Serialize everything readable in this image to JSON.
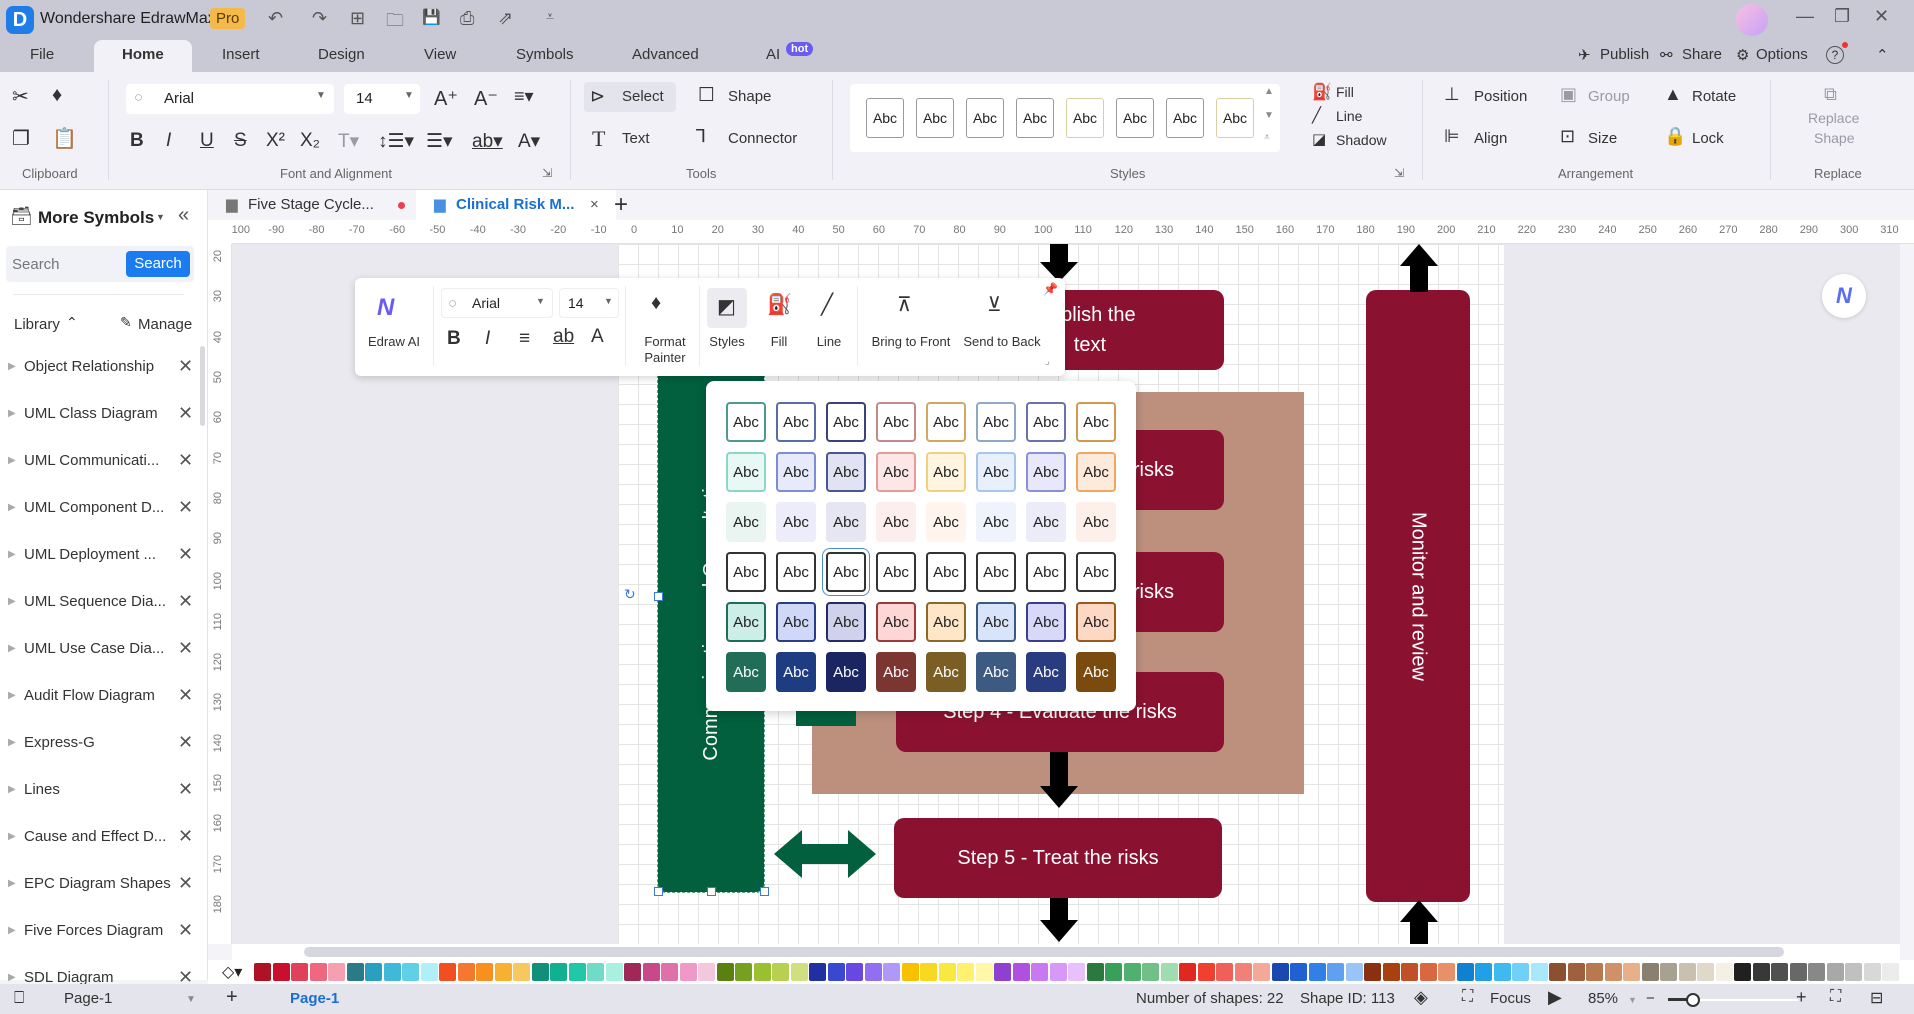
{
  "app": {
    "title": "Wondershare EdrawMax",
    "badge": "Pro",
    "logo_letter": "D"
  },
  "quick_access": [
    {
      "name": "undo-icon",
      "glyph": "↶"
    },
    {
      "name": "redo-icon",
      "glyph": "↷"
    },
    {
      "name": "new-icon",
      "glyph": "⊞"
    },
    {
      "name": "open-folder-icon",
      "glyph": "🗀"
    },
    {
      "name": "save-icon",
      "glyph": "💾"
    },
    {
      "name": "print-icon",
      "glyph": "⎙"
    },
    {
      "name": "export-icon",
      "glyph": "⇗"
    },
    {
      "name": "customize-icon",
      "glyph": "⩡"
    }
  ],
  "window_controls": {
    "minimize": "—",
    "restore": "❐",
    "close": "✕"
  },
  "menu": {
    "tabs": [
      "File",
      "Home",
      "Insert",
      "Design",
      "View",
      "Symbols",
      "Advanced",
      "AI"
    ],
    "active": "Home",
    "ai_badge": "hot",
    "right": {
      "publish": "Publish",
      "share": "Share",
      "options": "Options",
      "help": "?"
    }
  },
  "ribbon": {
    "clipboard": {
      "label": "Clipboard"
    },
    "font": {
      "label": "Font and Alignment",
      "font_name": "Arial",
      "font_size": "14"
    },
    "tools": {
      "label": "Tools",
      "select": "Select",
      "shape": "Shape",
      "text": "Text",
      "connector": "Connector"
    },
    "styles": {
      "label": "Styles",
      "swatch_text": "Abc",
      "fill": "Fill",
      "line": "Line",
      "shadow": "Shadow"
    },
    "arrangement": {
      "label": "Arrangement",
      "position": "Position",
      "group": "Group",
      "rotate": "Rotate",
      "align": "Align",
      "size": "Size",
      "lock": "Lock"
    },
    "replace": {
      "label": "Replace",
      "replace_shape_1": "Replace",
      "replace_shape_2": "Shape"
    }
  },
  "sidebar": {
    "title": "More Symbols",
    "search_placeholder": "Search",
    "search_button": "Search",
    "library_label": "Library",
    "manage_label": "Manage",
    "items": [
      "Object Relationship",
      "UML Class Diagram",
      "UML Communicati...",
      "UML Component D...",
      "UML Deployment ...",
      "UML Sequence Dia...",
      "UML Use Case Dia...",
      "Audit Flow Diagram",
      "Express-G",
      "Lines",
      "Cause and Effect D...",
      "EPC Diagram Shapes",
      "Five Forces Diagram",
      "SDL Diagram"
    ]
  },
  "doc_tabs": [
    {
      "label": "Five Stage Cycle...",
      "unsaved": true
    },
    {
      "label": "Clinical Risk M...",
      "active": true
    }
  ],
  "rulers": {
    "horizontal": [
      "-100",
      "-90",
      "-80",
      "-70",
      "-60",
      "-50",
      "-40",
      "-30",
      "-20",
      "-10",
      "0",
      "10",
      "20",
      "30",
      "40",
      "50",
      "60",
      "70",
      "80",
      "90",
      "100",
      "110",
      "120",
      "130",
      "140",
      "150",
      "160",
      "170",
      "180",
      "190",
      "200",
      "210",
      "220",
      "230",
      "240",
      "250",
      "260",
      "270",
      "280",
      "290",
      "300",
      "310"
    ],
    "vertical": [
      "20",
      "30",
      "40",
      "50",
      "60",
      "70",
      "80",
      "90",
      "100",
      "110",
      "120",
      "130",
      "140",
      "150",
      "160",
      "170",
      "180"
    ]
  },
  "diagram": {
    "communication": "Communication and Consultation",
    "monitor": "Monitor and review",
    "step1": "Step 1 - Establish the context",
    "step1_visible": "tablish the\ntext",
    "step2": "risks",
    "step3": "risks",
    "step4": "Step 4 - Evaluate the risks",
    "step5": "Step 5 - Treat the risks",
    "colors": {
      "maroon": "#8a1230",
      "green": "#02603e",
      "tan": "#bd907e"
    }
  },
  "mini_toolbar": {
    "edraw_ai": "Edraw AI",
    "font_name": "Arial",
    "font_size": "14",
    "format_painter_1": "Format",
    "format_painter_2": "Painter",
    "styles": "Styles",
    "fill": "Fill",
    "line": "Line",
    "bring_front": "Bring to Front",
    "send_back": "Send to Back"
  },
  "style_palette": {
    "text": "Abc",
    "rows": [
      {
        "fill": [
          "#ffffff",
          "#ffffff",
          "#ffffff",
          "#ffffff",
          "#ffffff",
          "#ffffff",
          "#ffffff",
          "#ffffff"
        ],
        "border": [
          "#4f9a8a",
          "#5b6aa8",
          "#3a4278",
          "#c28a88",
          "#d0a860",
          "#90a8c8",
          "#6a70b0",
          "#d09a50"
        ],
        "text": "#222"
      },
      {
        "fill": [
          "#e8f8f4",
          "#e6eafb",
          "#e1e3f3",
          "#fde6e6",
          "#fff5e0",
          "#e8f0fc",
          "#e8e8fa",
          "#feeadb"
        ],
        "border": [
          "#8ad8c4",
          "#7c8cd6",
          "#4a5598",
          "#e69a9a",
          "#f0d080",
          "#a8c4ec",
          "#8a8ed8",
          "#f0a860"
        ],
        "text": "#222"
      },
      {
        "fill": [
          "#eaf5f1",
          "#ececfa",
          "#e6e6f2",
          "#fdeeee",
          "#fff5ee",
          "#eef3fc",
          "#ececf8",
          "#fdf0ea"
        ],
        "border": [
          "transparent",
          "transparent",
          "transparent",
          "transparent",
          "transparent",
          "transparent",
          "transparent",
          "transparent"
        ],
        "text": "#222"
      },
      {
        "fill": [
          "#ffffff",
          "#ffffff",
          "#ffffff",
          "#ffffff",
          "#ffffff",
          "#ffffff",
          "#ffffff",
          "#ffffff"
        ],
        "border": [
          "#333",
          "#333",
          "#333",
          "#333",
          "#333",
          "#333",
          "#333",
          "#333"
        ],
        "text": "#222",
        "selected_index": 2
      },
      {
        "fill": [
          "#cdeee6",
          "#d0d8f8",
          "#cfd2ea",
          "#fdd6d6",
          "#ffe6c8",
          "#d8e4fa",
          "#d8d8f8",
          "#fdd8c4"
        ],
        "border": [
          "#1f6e5a",
          "#2a3e86",
          "#242c66",
          "#9a3a3a",
          "#8a6a2a",
          "#3a5a86",
          "#3a3e90",
          "#9a5a1a"
        ],
        "text": "#222"
      },
      {
        "fill": [
          "#216d56",
          "#1e3c82",
          "#1b2561",
          "#7b3632",
          "#7a5e24",
          "#3c5a82",
          "#2a3c80",
          "#7a4a0e"
        ],
        "border": [
          "transparent",
          "transparent",
          "transparent",
          "transparent",
          "transparent",
          "transparent",
          "transparent",
          "transparent"
        ],
        "text": "#fff"
      }
    ]
  },
  "color_bar": [
    "#b01225",
    "#c8102e",
    "#e0405a",
    "#f06880",
    "#f4a0b0",
    "#2a7a8a",
    "#2aa0c0",
    "#40b8d8",
    "#60d0e8",
    "#b0eef8",
    "#f05020",
    "#f47830",
    "#f89020",
    "#f8b030",
    "#f8c860",
    "#10907a",
    "#10b090",
    "#20c8a8",
    "#70dcc8",
    "#a8f0e0",
    "#a02858",
    "#c84888",
    "#e070a8",
    "#f098c8",
    "#f4c8dc",
    "#5a8010",
    "#78a020",
    "#98c030",
    "#b8d050",
    "#d0e080",
    "#2030a0",
    "#3848d0",
    "#6848e0",
    "#9070f0",
    "#b098f8",
    "#f8c000",
    "#f8d820",
    "#f8e840",
    "#fff070",
    "#fff8a8",
    "#9040d0",
    "#b050e0",
    "#c878f0",
    "#d898f8",
    "#e8c0fc",
    "#2a7a40",
    "#38a058",
    "#50b070",
    "#70c088",
    "#a0dcb0",
    "#e02820",
    "#f04030",
    "#f06058",
    "#f08078",
    "#f4a898",
    "#1848b0",
    "#2060d0",
    "#3080e8",
    "#60a0f0",
    "#98c4f8",
    "#8a3010",
    "#a84010",
    "#c05028",
    "#d86840",
    "#e89068",
    "#1080d0",
    "#20a0e8",
    "#40b8f0",
    "#70d0f8",
    "#a8e8fc",
    "#8a5030",
    "#a06040",
    "#b87850",
    "#d09068",
    "#e8b088",
    "#8a8070",
    "#a8a090",
    "#c8c0b0",
    "#e0d8c8",
    "#f4f0e4",
    "#202020",
    "#383838",
    "#505050",
    "#686868",
    "#888888",
    "#a8a8a8",
    "#c0c0c0",
    "#d8d8d8",
    "#ececec",
    "#ffffff"
  ],
  "status": {
    "page_selector": "Page-1",
    "page_tab": "Page-1",
    "shapes": "Number of shapes: 22",
    "shape_id": "Shape ID: 113",
    "focus": "Focus",
    "zoom": "85%",
    "zoom_value_percent": 85
  }
}
